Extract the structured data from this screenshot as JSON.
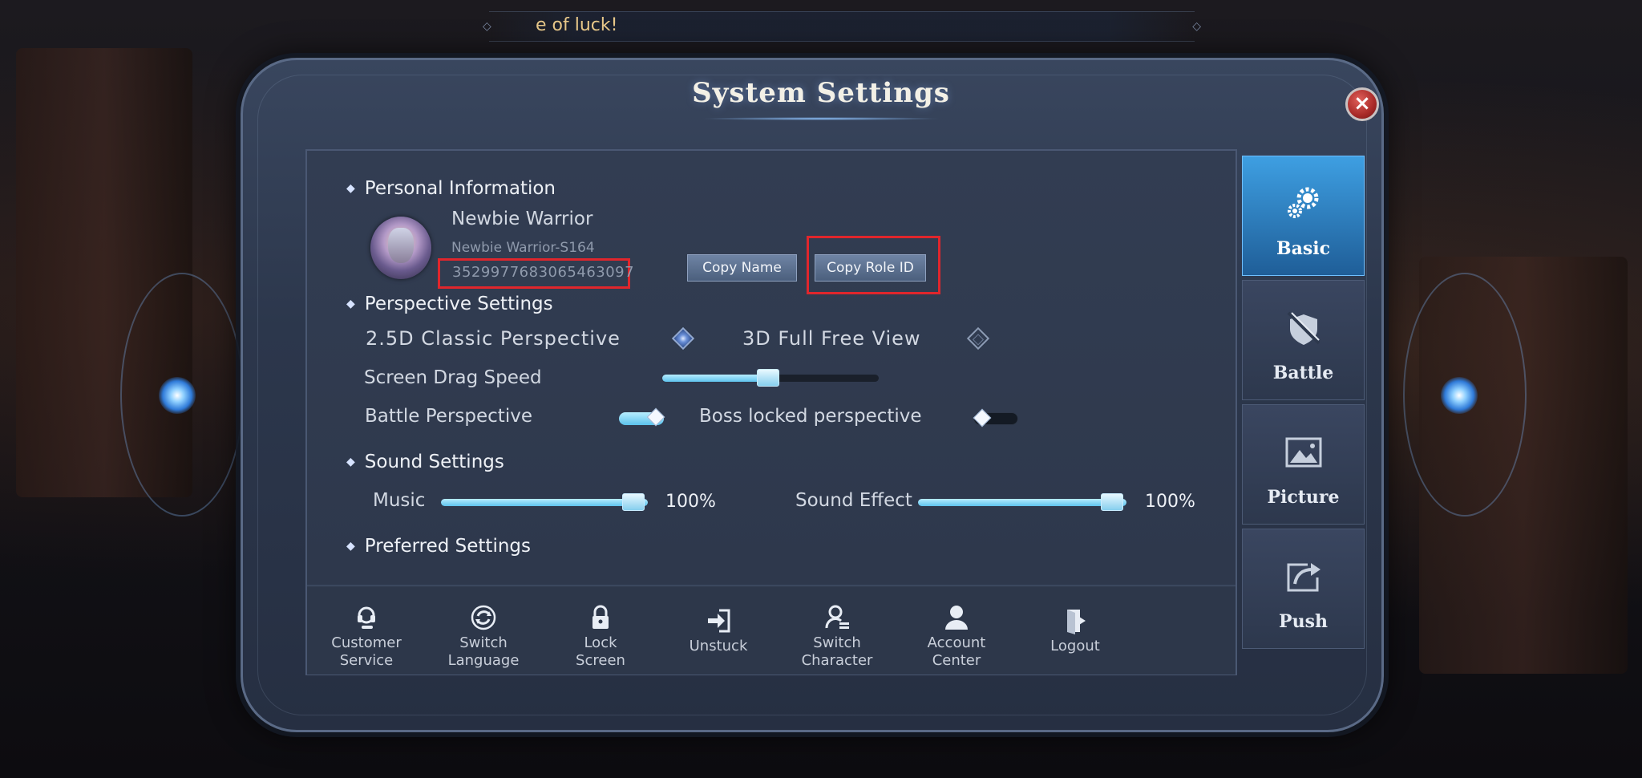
{
  "banner": {
    "text": "e of luck!"
  },
  "window": {
    "title": "System Settings",
    "close_symbol": "×"
  },
  "personal": {
    "section": "Personal Information",
    "name": "Newbie Warrior",
    "server_name": "Newbie Warrior-S164",
    "role_id": "3529977683065463097",
    "copy_name": "Copy Name",
    "copy_role_id": "Copy Role ID"
  },
  "perspective": {
    "section": "Perspective Settings",
    "option_classic": "2.5D Classic Perspective",
    "option_free": "3D Full Free View",
    "selected": "2.5D Classic Perspective",
    "drag_speed_label": "Screen Drag Speed",
    "drag_speed_value": 0.5,
    "battle_label": "Battle Perspective",
    "battle_on": true,
    "boss_label": "Boss locked perspective",
    "boss_on": false
  },
  "sound": {
    "section": "Sound Settings",
    "music_label": "Music",
    "music_value": "100%",
    "effect_label": "Sound Effect",
    "effect_value": "100%"
  },
  "preferred": {
    "section": "Preferred Settings"
  },
  "bottom": {
    "customer_service_1": "Customer",
    "customer_service_2": "Service",
    "switch_language_1": "Switch",
    "switch_language_2": "Language",
    "lock_screen_1": "Lock",
    "lock_screen_2": "Screen",
    "unstuck": "Unstuck",
    "switch_character_1": "Switch",
    "switch_character_2": "Character",
    "account_center_1": "Account",
    "account_center_2": "Center",
    "logout": "Logout"
  },
  "tabs": [
    {
      "label": "Basic",
      "icon": "gear-icon",
      "active": true
    },
    {
      "label": "Battle",
      "icon": "sword-shield-icon",
      "active": false
    },
    {
      "label": "Picture",
      "icon": "picture-icon",
      "active": false
    },
    {
      "label": "Push",
      "icon": "share-icon",
      "active": false
    }
  ],
  "colors": {
    "accent": "#5fc4ee",
    "highlight_box": "#e0262c",
    "active_tab": "#3e9fe2"
  }
}
